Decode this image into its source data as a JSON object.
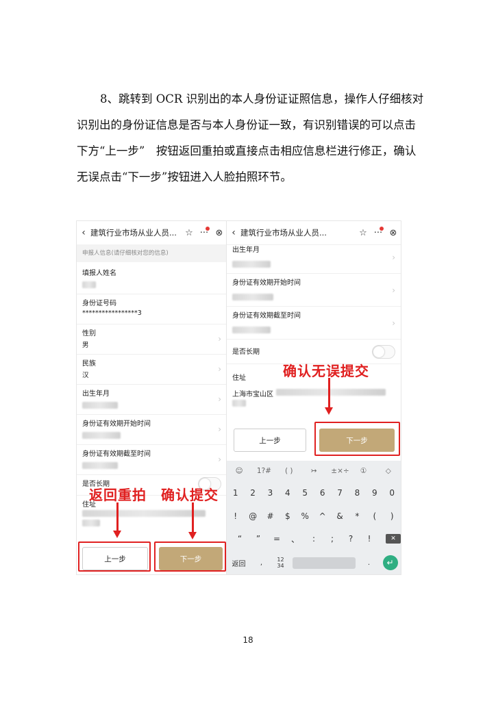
{
  "paragraph": {
    "line1": "8、跳转到 OCR 识别出的本人身份证证照信息，操作人仔细核对",
    "line2": "识别出的身份证信息是否与本人身份证一致，有识别错误的可以点击",
    "line3": "下方“上一步”　按钮返回重拍或直接点击相应信息栏进行修正，确认",
    "line4": "无误点击“下一步”按钮进入人脸拍照环节。"
  },
  "page_number": "18",
  "screen_a": {
    "title": "建筑行业市场从业人员...",
    "hint": "申报人信息(请仔细核对您的信息)",
    "fields": {
      "name_label": "填报人姓名",
      "id_label": "身份证号码",
      "id_value": "*****************3",
      "gender_label": "性别",
      "gender_value": "男",
      "ethnic_label": "民族",
      "ethnic_value": "汉",
      "birth_label": "出生年月",
      "valid_start_label": "身份证有效期开始时间",
      "valid_end_label": "身份证有效期截至时间",
      "longterm_label": "是否长期",
      "address_label": "住址"
    },
    "prev_button": "上一步",
    "next_button": "下一步",
    "annotation_prev": "返回重拍",
    "annotation_next": "确认提交"
  },
  "screen_b": {
    "title": "建筑行业市场从业人员...",
    "fields": {
      "birth_label": "出生年月",
      "valid_start_label": "身份证有效期开始时间",
      "valid_end_label": "身份证有效期截至时间",
      "longterm_label": "是否长期",
      "address_label": "住址",
      "address_value": "上海市宝山区"
    },
    "prev_button": "上一步",
    "next_button": "下一步",
    "annotation": "确认无误提交",
    "keyboard": {
      "toolbar": [
        "☺",
        "1?#",
        "( )",
        "↣",
        "±×÷",
        "①",
        "◇"
      ],
      "digits": [
        "1",
        "2",
        "3",
        "4",
        "5",
        "6",
        "7",
        "8",
        "9",
        "0"
      ],
      "symbols1": [
        "!",
        "@",
        "#",
        "$",
        "%",
        "^",
        "&",
        "*",
        "(",
        ")"
      ],
      "symbols2": [
        "“",
        "”",
        "=",
        "、",
        ":",
        ";",
        "?",
        "!"
      ],
      "back_key": "返回",
      "comma_key": ",",
      "num_key": "12 34",
      "period_key": "."
    }
  },
  "colors": {
    "accent": "#c2a878",
    "annotation": "#e02020",
    "enter_key": "#2fae82"
  }
}
